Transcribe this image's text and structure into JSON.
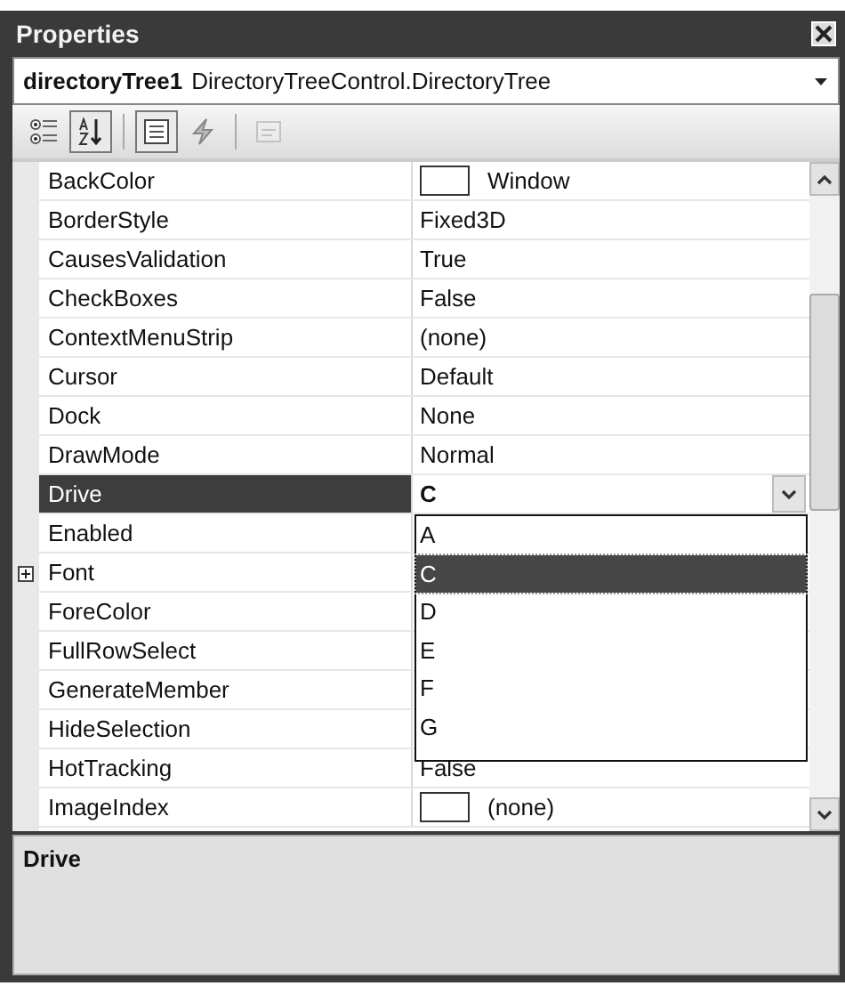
{
  "window": {
    "title": "Properties"
  },
  "object_selector": {
    "name": "directoryTree1",
    "type": "DirectoryTreeControl.DirectoryTree"
  },
  "toolbar": [
    {
      "kind": "categorized",
      "selected": false,
      "disabled": false
    },
    {
      "kind": "alphabetical",
      "selected": true,
      "disabled": false
    },
    {
      "kind": "properties",
      "selected": true,
      "disabled": false
    },
    {
      "kind": "events",
      "selected": false,
      "disabled": false
    },
    {
      "kind": "pages",
      "selected": false,
      "disabled": true
    }
  ],
  "properties": [
    {
      "name": "BackColor",
      "value": "Window",
      "kind": "color",
      "selected": false
    },
    {
      "name": "BorderStyle",
      "value": "Fixed3D",
      "kind": "text",
      "selected": false
    },
    {
      "name": "CausesValidation",
      "value": "True",
      "kind": "text",
      "selected": false
    },
    {
      "name": "CheckBoxes",
      "value": "False",
      "kind": "text",
      "selected": false
    },
    {
      "name": "ContextMenuStrip",
      "value": "(none)",
      "kind": "text",
      "selected": false
    },
    {
      "name": "Cursor",
      "value": "Default",
      "kind": "text",
      "selected": false
    },
    {
      "name": "Dock",
      "value": "None",
      "kind": "text",
      "selected": false
    },
    {
      "name": "DrawMode",
      "value": "Normal",
      "kind": "text",
      "selected": false
    },
    {
      "name": "Drive",
      "value": "C",
      "kind": "list",
      "selected": true
    },
    {
      "name": "Enabled",
      "kind": "text",
      "selected": false
    },
    {
      "name": "Font",
      "kind": "group",
      "selected": false
    },
    {
      "name": "ForeColor",
      "kind": "text",
      "selected": false
    },
    {
      "name": "FullRowSelect",
      "kind": "text",
      "selected": false
    },
    {
      "name": "GenerateMember",
      "kind": "text",
      "selected": false
    },
    {
      "name": "HideSelection",
      "kind": "text",
      "selected": false
    },
    {
      "name": "HotTracking",
      "value": "False",
      "kind": "text",
      "selected": false
    },
    {
      "name": "ImageIndex",
      "value": "(none)",
      "kind": "color",
      "selected": false
    }
  ],
  "dropdown": {
    "options": [
      {
        "label": "A",
        "selected": false
      },
      {
        "label": "C",
        "selected": true
      },
      {
        "label": "D",
        "selected": false
      },
      {
        "label": "E",
        "selected": false
      },
      {
        "label": "F",
        "selected": false
      },
      {
        "label": "G",
        "selected": false
      }
    ]
  },
  "description": {
    "title": "Drive"
  }
}
